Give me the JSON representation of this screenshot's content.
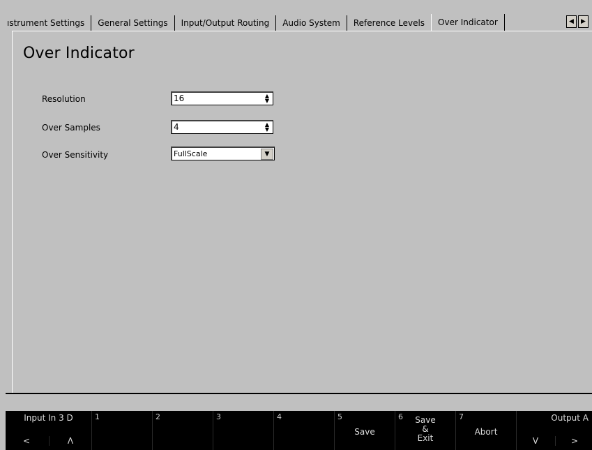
{
  "tabs": [
    {
      "label": "ıstrument Settings"
    },
    {
      "label": "General Settings"
    },
    {
      "label": "Input/Output Routing"
    },
    {
      "label": "Audio System"
    },
    {
      "label": "Reference Levels"
    },
    {
      "label": "Over Indicator"
    }
  ],
  "active_tab": "Over Indicator",
  "arrows": {
    "left": "◀",
    "right": "▶"
  },
  "page_title": "Over Indicator",
  "settings": {
    "resolution": {
      "label": "Resolution",
      "value": "16",
      "spin": "▲\n▼"
    },
    "over_samples": {
      "label": "Over Samples",
      "value": "4",
      "spin": "▲\n▼"
    },
    "over_sensitivity": {
      "label": "Over Sensitivity",
      "value": "FullScale",
      "drop": "▼"
    }
  },
  "footer": {
    "input_label": "Input In 3 D",
    "output_label": "Output A",
    "prev": "<",
    "up": "Λ",
    "down": "V",
    "next": ">",
    "keys": [
      {
        "num": "1",
        "label": ""
      },
      {
        "num": "2",
        "label": ""
      },
      {
        "num": "3",
        "label": ""
      },
      {
        "num": "4",
        "label": ""
      },
      {
        "num": "5",
        "label": "Save"
      },
      {
        "num": "6",
        "label": "Save & Exit"
      },
      {
        "num": "7",
        "label": "Abort"
      }
    ],
    "save_exit": {
      "line1": "Save",
      "line2": "&",
      "line3": "Exit"
    }
  }
}
